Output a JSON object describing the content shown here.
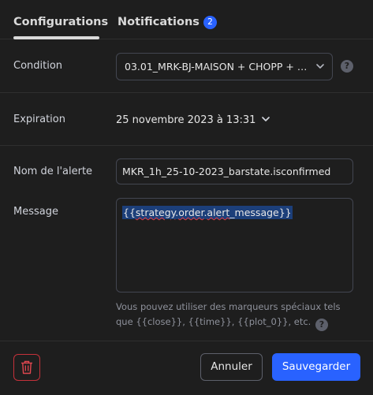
{
  "tabs": {
    "configurations": "Configurations",
    "notifications": "Notifications",
    "notifications_badge": "2"
  },
  "condition": {
    "label": "Condition",
    "value": "03.01_MRK-BJ-MAISON + CHOPP + V..."
  },
  "expiration": {
    "label": "Expiration",
    "value": "25 novembre 2023 à 13:31"
  },
  "alert_name": {
    "label": "Nom de l'alerte",
    "value": "MKR_1h_25-10-2023_barstate.isconfirmed"
  },
  "message": {
    "label": "Message",
    "prefix": "{{",
    "word1": "strategy",
    "dot1": ".",
    "word2": "order",
    "dot2": ".",
    "word3": "alert",
    "suffix": "_message}}",
    "hint": "Vous pouvez utiliser des marqueurs spéciaux tels que {{close}}, {{time}}, {{plot_0}}, etc."
  },
  "help_glyph": "?",
  "buttons": {
    "cancel": "Annuler",
    "save": "Sauvegarder"
  },
  "icons": {
    "help": "question-circle",
    "chevron": "chevron-down",
    "delete": "trash"
  },
  "colors": {
    "accent": "#2962ff",
    "danger": "#c4313a",
    "background": "#1e1e1e"
  }
}
